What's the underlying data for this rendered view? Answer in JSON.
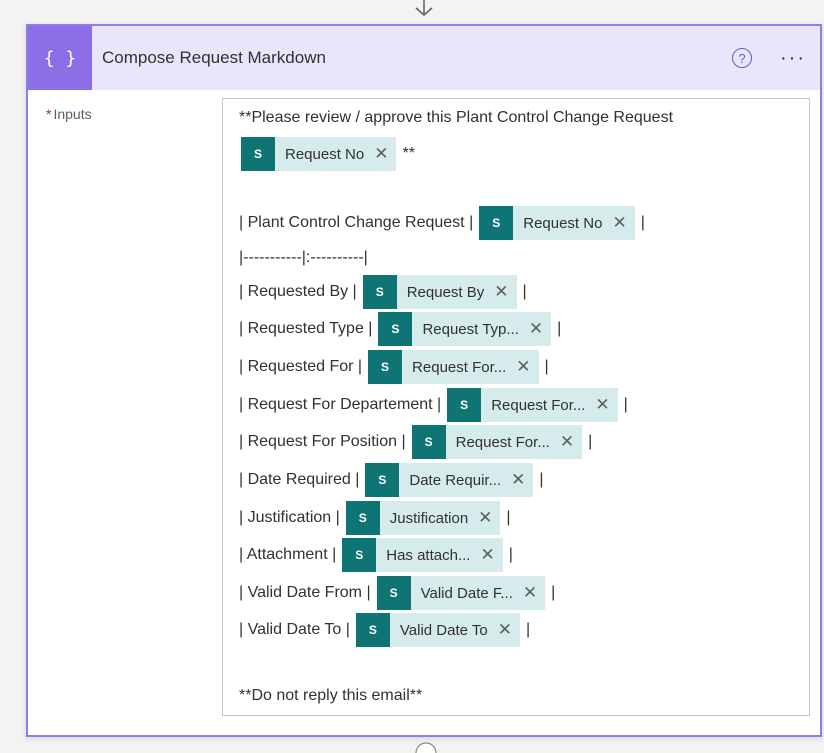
{
  "card": {
    "title": "Compose Request Markdown",
    "action_icon_glyph": "{ }",
    "help_glyph": "?",
    "more_glyph": "···",
    "accent_color": "#8c6ee6",
    "header_bg": "#e9e5fb"
  },
  "inputs": {
    "required_mark": "*",
    "label": "Inputs"
  },
  "token_icon_text": "S",
  "token_close": "✕",
  "editor": {
    "line1": "**Please review / approve this Plant Control Change Request",
    "line2_after": "**",
    "table_title_prefix": "| Plant Control Change Request |",
    "separator": "|-----------|:----------|",
    "pipe": "|",
    "rows": [
      {
        "label": "| Requested By |",
        "token": "Request By"
      },
      {
        "label": "| Requested Type |",
        "token": "Request Typ..."
      },
      {
        "label": "| Requested For |",
        "token": "Request For..."
      },
      {
        "label": "| Request For Departement |",
        "token": "Request For..."
      },
      {
        "label": "| Request For Position |",
        "token": "Request For..."
      },
      {
        "label": "| Date Required |",
        "token": "Date Requir..."
      },
      {
        "label": "| Justification |",
        "token": "Justification"
      },
      {
        "label": "| Attachment |",
        "token": "Has attach..."
      },
      {
        "label": "| Valid Date From |",
        "token": "Valid Date F..."
      },
      {
        "label": "| Valid Date To |",
        "token": "Valid Date To"
      }
    ],
    "request_no_token": "Request No",
    "footer": "**Do not reply this email**"
  }
}
